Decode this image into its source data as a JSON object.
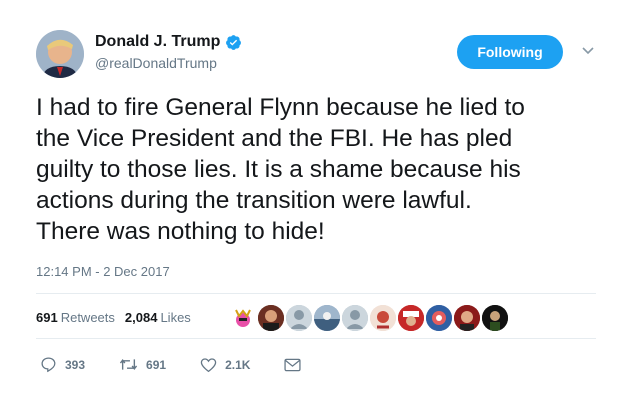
{
  "author": {
    "name": "Donald J. Trump",
    "handle": "@realDonaldTrump",
    "verified_icon": "verified-badge-icon",
    "avatar_icon": "profile-avatar"
  },
  "follow_button": {
    "label": "Following",
    "color": "#1da1f2"
  },
  "tweet": {
    "text": "I had to fire General Flynn because he lied to\nthe Vice President and the FBI. He has pled\nguilty to those lies. It is a shame because his\nactions during the transition were lawful.\nThere was nothing to hide!",
    "timestamp": "12:14 PM - 2 Dec 2017"
  },
  "stats": {
    "retweets_count": "691",
    "retweets_label": "Retweets",
    "likes_count": "2,084",
    "likes_label": "Likes"
  },
  "liker_avatars": [
    "avatar-1",
    "avatar-2",
    "avatar-3",
    "avatar-4",
    "avatar-5",
    "avatar-6",
    "avatar-7",
    "avatar-8",
    "avatar-9",
    "avatar-10"
  ],
  "actions": {
    "replies": "393",
    "retweets": "691",
    "likes": "2.1K"
  },
  "colors": {
    "text": "#14171a",
    "secondary": "#657786",
    "divider": "#e6ecf0",
    "accent": "#1da1f2"
  }
}
